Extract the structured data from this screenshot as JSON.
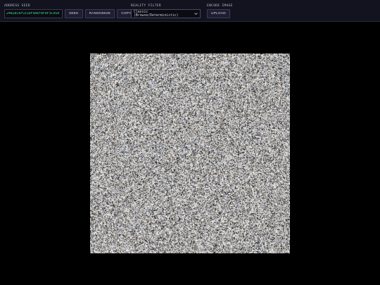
{
  "toolbar": {
    "address": {
      "label": "ADDRESS SEED",
      "value": "24828C6FCE1DF9AEF8F8F3C95A",
      "seek_label": "SEEK",
      "randomize_label": "RANDOMIZE",
      "copy_label": "COPY"
    },
    "filter": {
      "label": "REALITY FILTER",
      "selected": "Classic (Browse/Deterministic)"
    },
    "encode": {
      "label": "ENCODE IMAGE",
      "upload_label": "UPLOAD"
    }
  },
  "colors": {
    "background": "#000000",
    "toolbar": "#131320",
    "seed_text": "#3ddc84",
    "label_text": "#b8b8c8"
  },
  "icons": {
    "select_arrow": "chevron-down-icon"
  },
  "canvas": {
    "content": "random-noise-image"
  }
}
